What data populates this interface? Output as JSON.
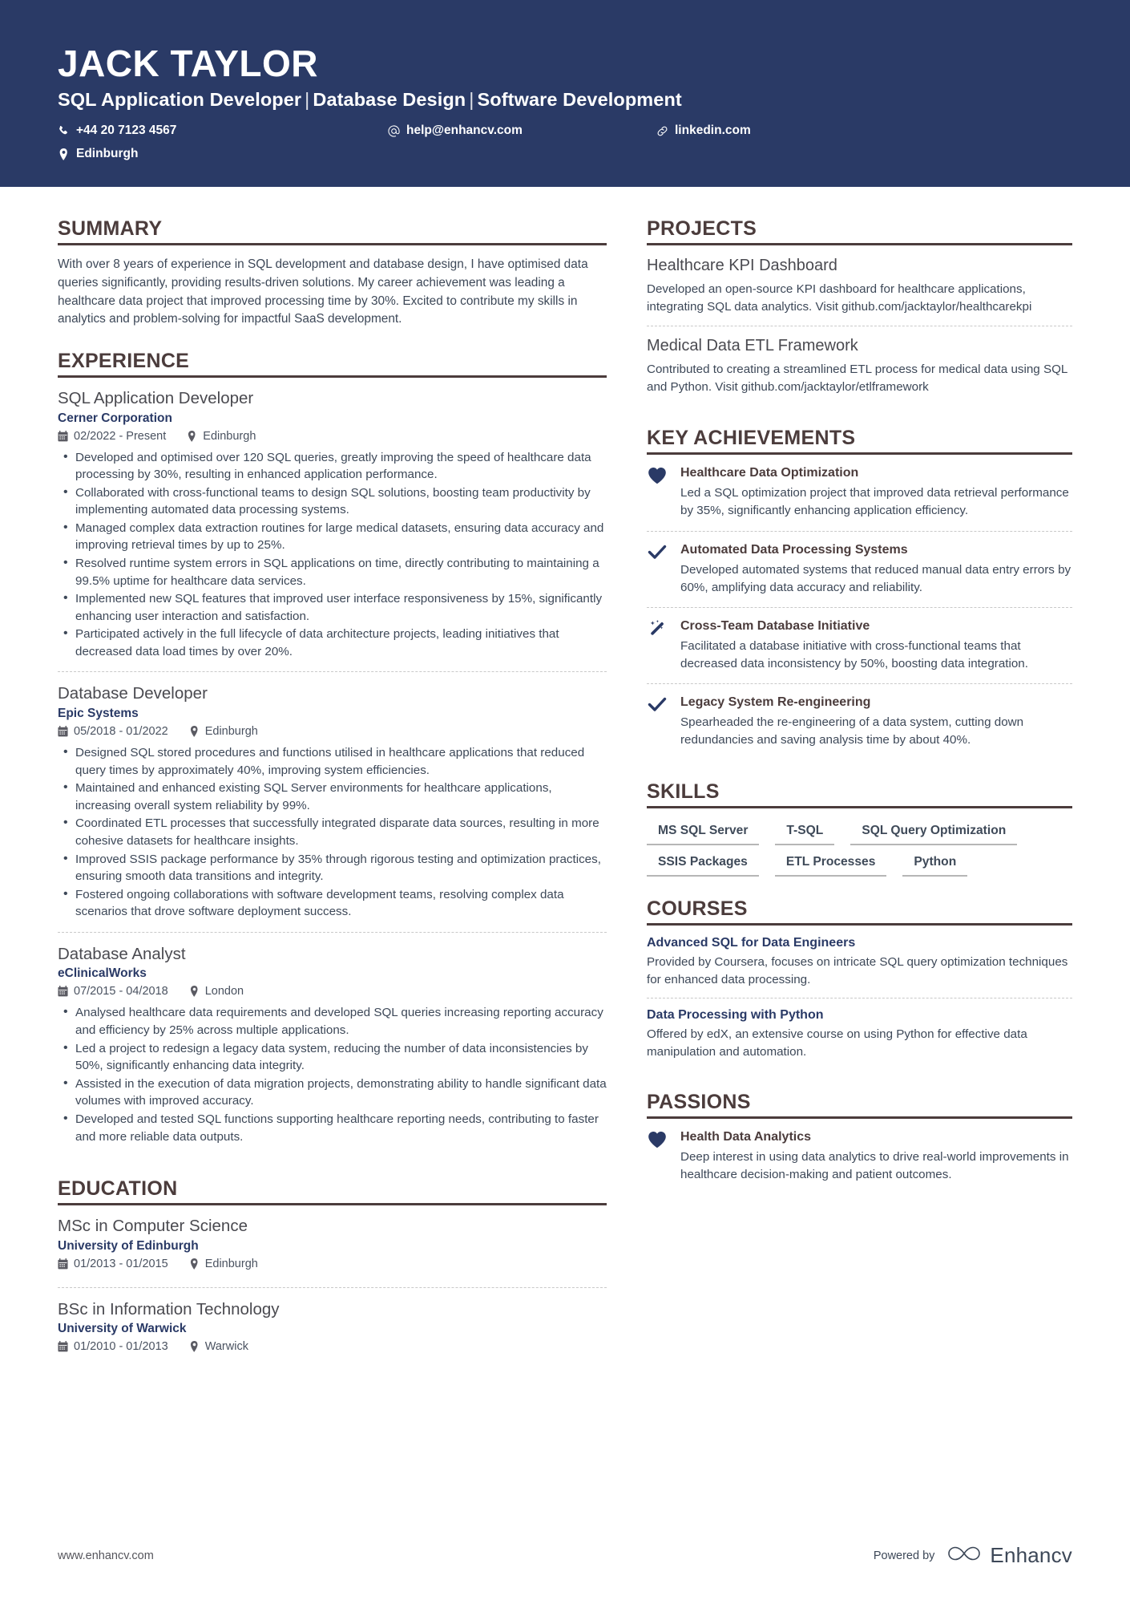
{
  "colors": {
    "header_bg": "#2a3a66",
    "accent_navy": "#2a3a66",
    "heading_brown": "#4b3c3c",
    "body_text": "#3d4858"
  },
  "header": {
    "name": "JACK TAYLOR",
    "headline_parts": [
      "SQL Application Developer",
      "Database Design",
      "Software Development"
    ],
    "headline": "SQL Application Developer | Database Design | Software Development",
    "contacts": {
      "phone": "+44 20 7123 4567",
      "email": "help@enhancv.com",
      "linkedin": "linkedin.com",
      "location": "Edinburgh"
    }
  },
  "left": {
    "summary": {
      "title": "SUMMARY",
      "text": "With over 8 years of experience in SQL development and database design, I have optimised data queries significantly, providing results-driven solutions. My career achievement was leading a healthcare data project that improved processing time by 30%. Excited to contribute my skills in analytics and problem-solving for impactful SaaS development."
    },
    "experience": {
      "title": "EXPERIENCE",
      "entries": [
        {
          "role": "SQL Application Developer",
          "company": "Cerner Corporation",
          "dates": "02/2022 - Present",
          "location": "Edinburgh",
          "bullets": [
            "Developed and optimised over 120 SQL queries, greatly improving the speed of healthcare data processing by 30%, resulting in enhanced application performance.",
            "Collaborated with cross-functional teams to design SQL solutions, boosting team productivity by implementing automated data processing systems.",
            "Managed complex data extraction routines for large medical datasets, ensuring data accuracy and improving retrieval times by up to 25%.",
            "Resolved runtime system errors in SQL applications on time, directly contributing to maintaining a 99.5% uptime for healthcare data services.",
            "Implemented new SQL features that improved user interface responsiveness by 15%, significantly enhancing user interaction and satisfaction.",
            "Participated actively in the full lifecycle of data architecture projects, leading initiatives that decreased data load times by over 20%."
          ]
        },
        {
          "role": "Database Developer",
          "company": "Epic Systems",
          "dates": "05/2018 - 01/2022",
          "location": "Edinburgh",
          "bullets": [
            "Designed SQL stored procedures and functions utilised in healthcare applications that reduced query times by approximately 40%, improving system efficiencies.",
            "Maintained and enhanced existing SQL Server environments for healthcare applications, increasing overall system reliability by 99%.",
            "Coordinated ETL processes that successfully integrated disparate data sources, resulting in more cohesive datasets for healthcare insights.",
            "Improved SSIS package performance by 35% through rigorous testing and optimization practices, ensuring smooth data transitions and integrity.",
            "Fostered ongoing collaborations with software development teams, resolving complex data scenarios that drove software deployment success."
          ]
        },
        {
          "role": "Database Analyst",
          "company": "eClinicalWorks",
          "dates": "07/2015 - 04/2018",
          "location": "London",
          "bullets": [
            "Analysed healthcare data requirements and developed SQL queries increasing reporting accuracy and efficiency by 25% across multiple applications.",
            "Led a project to redesign a legacy data system, reducing the number of data inconsistencies by 50%, significantly enhancing data integrity.",
            "Assisted in the execution of data migration projects, demonstrating ability to handle significant data volumes with improved accuracy.",
            "Developed and tested SQL functions supporting healthcare reporting needs, contributing to faster and more reliable data outputs."
          ]
        }
      ]
    },
    "education": {
      "title": "EDUCATION",
      "entries": [
        {
          "degree": "MSc in Computer Science",
          "school": "University of Edinburgh",
          "dates": "01/2013 - 01/2015",
          "location": "Edinburgh"
        },
        {
          "degree": "BSc in Information Technology",
          "school": "University of Warwick",
          "dates": "01/2010 - 01/2013",
          "location": "Warwick"
        }
      ]
    }
  },
  "right": {
    "projects": {
      "title": "PROJECTS",
      "items": [
        {
          "name": "Healthcare KPI Dashboard",
          "desc": "Developed an open-source KPI dashboard for healthcare applications, integrating SQL data analytics. Visit github.com/jacktaylor/healthcarekpi"
        },
        {
          "name": "Medical Data ETL Framework",
          "desc": "Contributed to creating a streamlined ETL process for medical data using SQL and Python. Visit github.com/jacktaylor/etlframework"
        }
      ]
    },
    "achievements": {
      "title": "KEY ACHIEVEMENTS",
      "items": [
        {
          "icon": "heart-icon",
          "title": "Healthcare Data Optimization",
          "desc": "Led a SQL optimization project that improved data retrieval performance by 35%, significantly enhancing application efficiency."
        },
        {
          "icon": "check-icon",
          "title": "Automated Data Processing Systems",
          "desc": "Developed automated systems that reduced manual data entry errors by 60%, amplifying data accuracy and reliability."
        },
        {
          "icon": "magic-wand-icon",
          "title": "Cross-Team Database Initiative",
          "desc": "Facilitated a database initiative with cross-functional teams that decreased data inconsistency by 50%, boosting data integration."
        },
        {
          "icon": "check-icon",
          "title": "Legacy System Re-engineering",
          "desc": "Spearheaded the re-engineering of a data system, cutting down redundancies and saving analysis time by about 40%."
        }
      ]
    },
    "skills": {
      "title": "SKILLS",
      "items": [
        "MS SQL Server",
        "T-SQL",
        "SQL Query Optimization",
        "SSIS Packages",
        "ETL Processes",
        "Python"
      ]
    },
    "courses": {
      "title": "COURSES",
      "items": [
        {
          "name": "Advanced SQL for Data Engineers",
          "desc": "Provided by Coursera, focuses on intricate SQL query optimization techniques for enhanced data processing."
        },
        {
          "name": "Data Processing with Python",
          "desc": "Offered by edX, an extensive course on using Python for effective data manipulation and automation."
        }
      ]
    },
    "passions": {
      "title": "PASSIONS",
      "items": [
        {
          "icon": "heart-icon",
          "title": "Health Data Analytics",
          "desc": "Deep interest in using data analytics to drive real-world improvements in healthcare decision-making and patient outcomes."
        }
      ]
    }
  },
  "footer": {
    "url": "www.enhancv.com",
    "powered_by": "Powered by",
    "brand": "Enhancv"
  }
}
